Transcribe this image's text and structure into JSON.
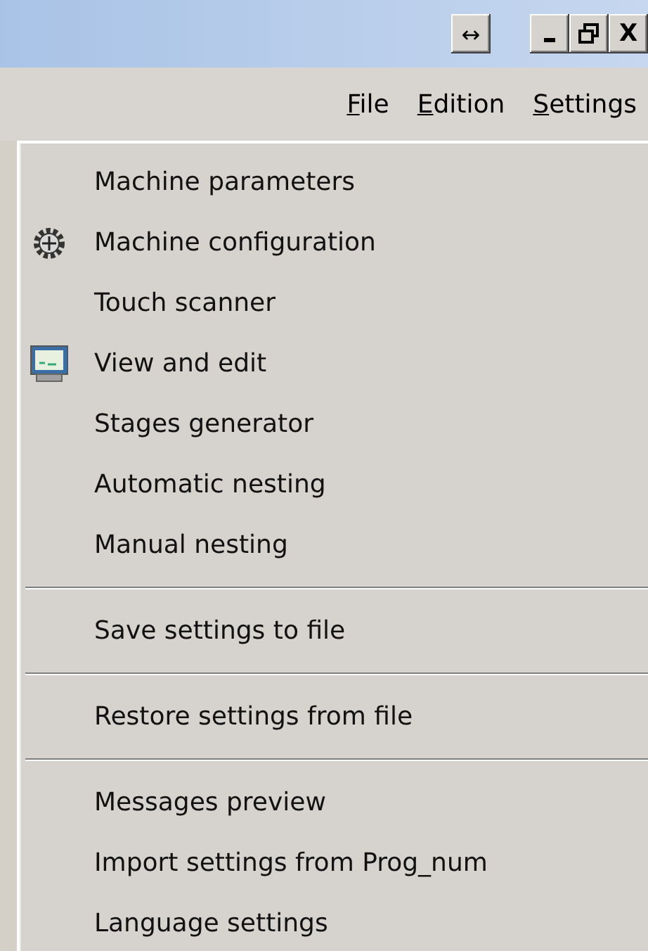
{
  "title_bar": {
    "buttons": [
      {
        "kind": "resize",
        "glyph": "↔"
      },
      {
        "kind": "minimize"
      },
      {
        "kind": "restore"
      },
      {
        "kind": "close",
        "glyph": "X"
      }
    ]
  },
  "menu_bar": [
    {
      "accel": "F",
      "rest": "ile"
    },
    {
      "accel": "E",
      "rest": "dition"
    },
    {
      "accel": "S",
      "rest": "ettings"
    }
  ],
  "menu": [
    {
      "kind": "item",
      "label": "Machine parameters"
    },
    {
      "kind": "gear",
      "label": "Machine configuration"
    },
    {
      "kind": "item",
      "label": "Touch scanner"
    },
    {
      "kind": "monitor",
      "label": "View and edit"
    },
    {
      "kind": "item",
      "label": "Stages generator"
    },
    {
      "kind": "item",
      "label": "Automatic nesting"
    },
    {
      "kind": "item",
      "label": "Manual nesting"
    },
    {
      "kind": "separator"
    },
    {
      "kind": "item",
      "label": "Save settings to file"
    },
    {
      "kind": "separator"
    },
    {
      "kind": "item",
      "label": "Restore settings from file"
    },
    {
      "kind": "separator"
    },
    {
      "kind": "item",
      "label": "Messages preview"
    },
    {
      "kind": "item",
      "label": "Import settings from Prog_num"
    },
    {
      "kind": "item",
      "label": "Language settings"
    }
  ]
}
